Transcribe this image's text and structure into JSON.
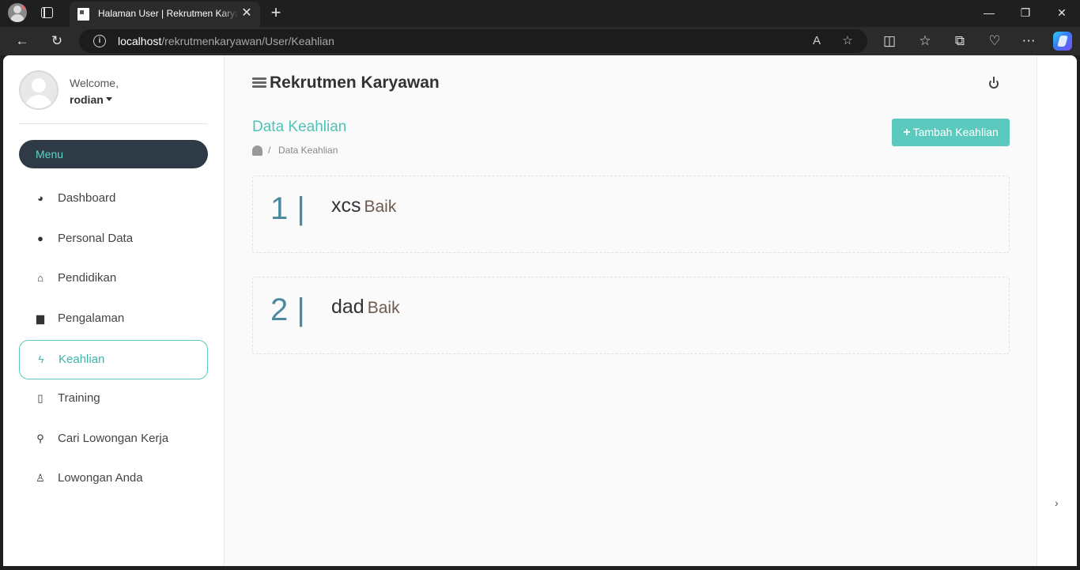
{
  "browser": {
    "tab_title": "Halaman User | Rekrutmen Karyawan",
    "url_host": "localhost",
    "url_path": "/rekrutmenkaryawan/User/Keahlian",
    "new_tab_glyph": "+",
    "close_glyph": "✕",
    "window_controls": {
      "minimize": "—",
      "maximize": "❐",
      "close": "✕"
    }
  },
  "sidebar": {
    "welcome": "Welcome,",
    "username": "rodian",
    "menu_label": "Menu",
    "items": [
      {
        "label": "Dashboard",
        "icon": "dashboard-icon",
        "active": false
      },
      {
        "label": "Personal Data",
        "icon": "user-icon",
        "active": false
      },
      {
        "label": "Pendidikan",
        "icon": "university-icon",
        "active": false
      },
      {
        "label": "Pengalaman",
        "icon": "briefcase-icon",
        "active": false
      },
      {
        "label": "Keahlian",
        "icon": "bolt-icon",
        "active": true
      },
      {
        "label": "Training",
        "icon": "file-icon",
        "active": false
      },
      {
        "label": "Cari Lowongan Kerja",
        "icon": "search-icon",
        "active": false
      },
      {
        "label": "Lowongan Anda",
        "icon": "person-icon",
        "active": false
      }
    ]
  },
  "header": {
    "brand": "Rekrutmen Karyawan"
  },
  "content": {
    "title": "Data Keahlian",
    "breadcrumb_sep": "/",
    "breadcrumb": "Data Keahlian",
    "add_button": "Tambah Keahlian",
    "skills": [
      {
        "number": "1 |",
        "name": "xcs",
        "level": "Baik"
      },
      {
        "number": "2 |",
        "name": "dad",
        "level": "Baik"
      }
    ]
  },
  "colors": {
    "accent": "#5bc9bd",
    "menu_bg": "#2e3a46",
    "number": "#4d8aa0"
  }
}
